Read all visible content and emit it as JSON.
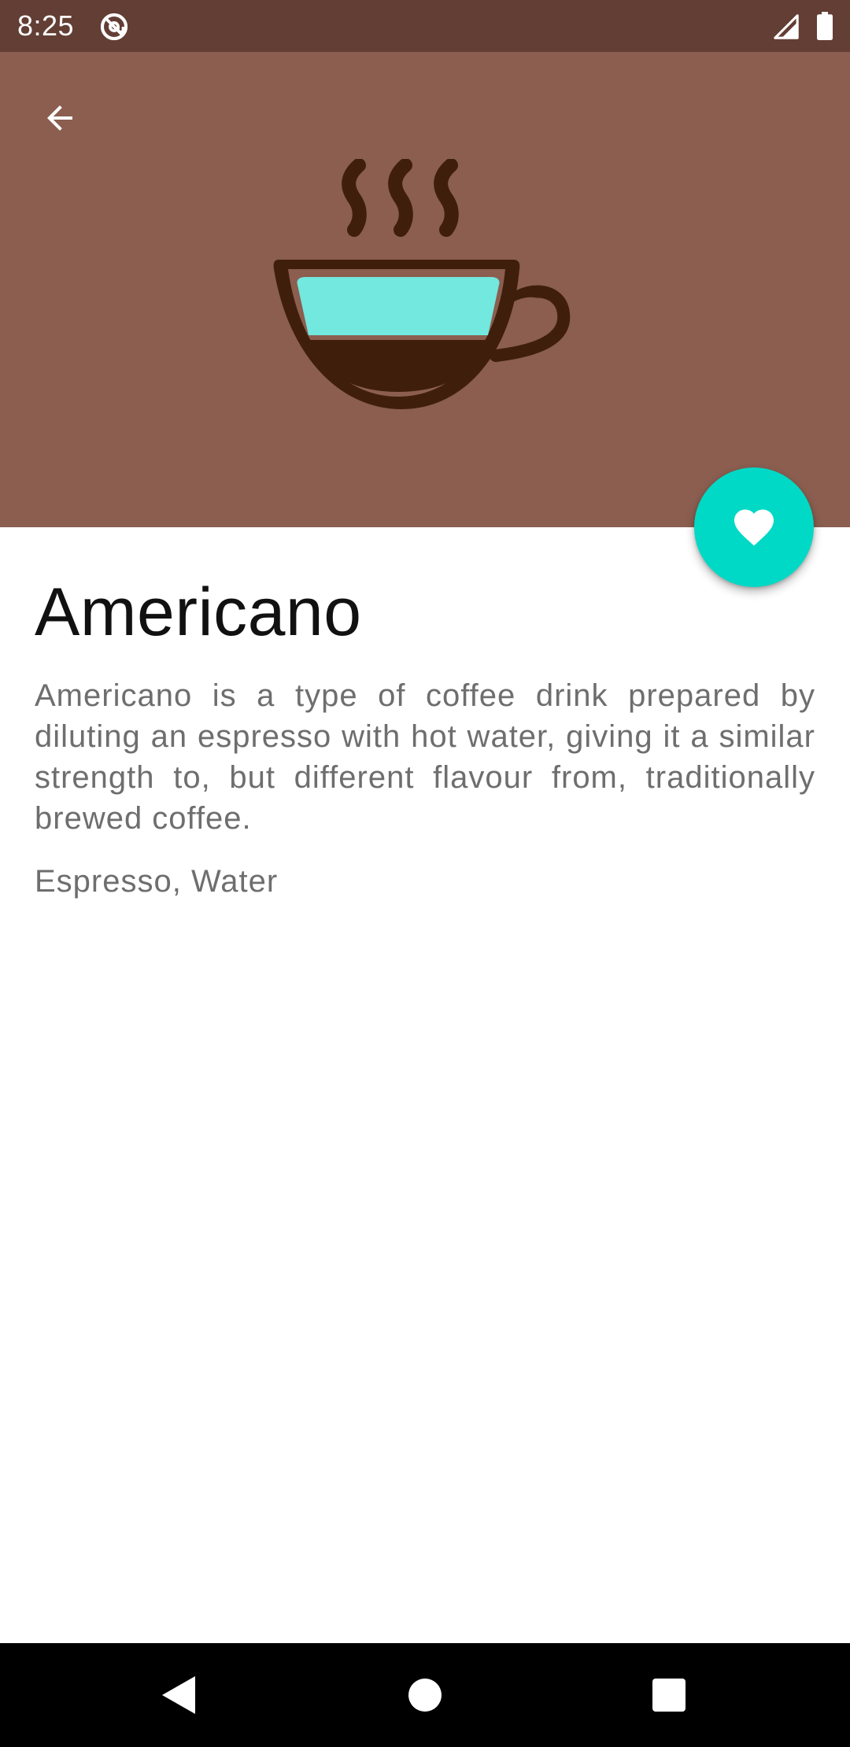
{
  "status_bar": {
    "time": "8:25",
    "icons": [
      "alternate-email-icon",
      "cellular-signal-icon",
      "battery-full-icon"
    ]
  },
  "header": {
    "back_icon": "arrow-back-icon",
    "illustration": "coffee-cup-icon",
    "background_color": "#8b5e50"
  },
  "fab": {
    "icon": "heart-icon",
    "color": "#00d9c5"
  },
  "drink": {
    "name": "Americano",
    "description": "Americano is a type of coffee drink prepared by diluting an espresso with hot water, giving it a similar strength to, but different flavour from, traditionally brewed coffee.",
    "ingredients": "Espresso, Water"
  },
  "nav_bar": {
    "buttons": [
      "nav-back-icon",
      "nav-home-icon",
      "nav-recents-icon"
    ]
  }
}
